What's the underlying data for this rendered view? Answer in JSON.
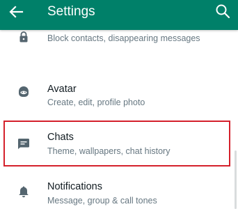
{
  "appbar": {
    "title": "Settings",
    "back_icon": "arrow-left-icon",
    "search_icon": "search-icon",
    "color": "#008069"
  },
  "settings_items": [
    {
      "id": "privacy",
      "icon": "lock-icon",
      "title": "",
      "subtitle": "Block contacts, disappearing messages"
    },
    {
      "id": "avatar",
      "icon": "avatar-face-icon",
      "title": "Avatar",
      "subtitle": "Create, edit, profile photo"
    },
    {
      "id": "chats",
      "icon": "chat-icon",
      "title": "Chats",
      "subtitle": "Theme, wallpapers, chat history",
      "highlighted": true
    },
    {
      "id": "notifications",
      "icon": "bell-icon",
      "title": "Notifications",
      "subtitle": "Message, group & call tones"
    }
  ],
  "highlight_color": "#d4202b"
}
